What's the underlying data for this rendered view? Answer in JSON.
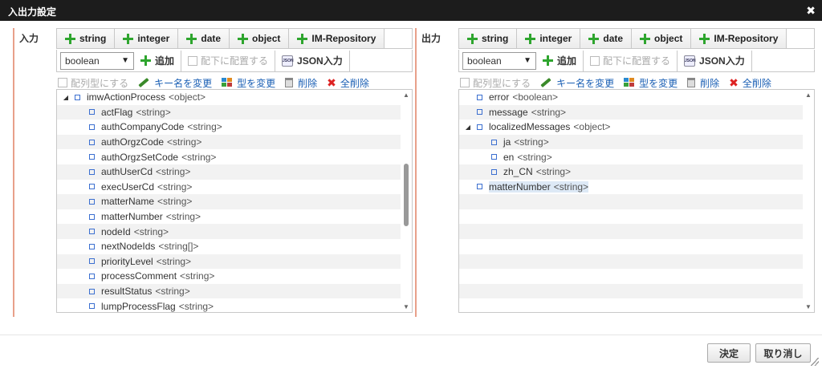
{
  "window": {
    "title": "入出力設定",
    "close_icon": "close-icon"
  },
  "input": {
    "label": "入力",
    "type_buttons": [
      "string",
      "integer",
      "date",
      "object",
      "IM-Repository"
    ],
    "select_value": "boolean",
    "add_label": "追加",
    "place_under_label": "配下に配置する",
    "json_input_label": "JSON入力",
    "make_array_label": "配列型にする",
    "rename_key_label": "キー名を変更",
    "change_type_label": "型を変更",
    "delete_label": "削除",
    "delete_all_label": "全削除",
    "tree": [
      {
        "name": "imwActionProcess",
        "type": "<object>",
        "level": 0,
        "expandable": true
      },
      {
        "name": "actFlag",
        "type": "<string>",
        "level": 1
      },
      {
        "name": "authCompanyCode",
        "type": "<string>",
        "level": 1
      },
      {
        "name": "authOrgzCode",
        "type": "<string>",
        "level": 1
      },
      {
        "name": "authOrgzSetCode",
        "type": "<string>",
        "level": 1
      },
      {
        "name": "authUserCd",
        "type": "<string>",
        "level": 1
      },
      {
        "name": "execUserCd",
        "type": "<string>",
        "level": 1
      },
      {
        "name": "matterName",
        "type": "<string>",
        "level": 1
      },
      {
        "name": "matterNumber",
        "type": "<string>",
        "level": 1
      },
      {
        "name": "nodeId",
        "type": "<string>",
        "level": 1
      },
      {
        "name": "nextNodeIds",
        "type": "<string[]>",
        "level": 1
      },
      {
        "name": "priorityLevel",
        "type": "<string>",
        "level": 1
      },
      {
        "name": "processComment",
        "type": "<string>",
        "level": 1
      },
      {
        "name": "resultStatus",
        "type": "<string>",
        "level": 1
      },
      {
        "name": "lumpProcessFlag",
        "type": "<string>",
        "level": 1
      }
    ]
  },
  "output": {
    "label": "出力",
    "type_buttons": [
      "string",
      "integer",
      "date",
      "object",
      "IM-Repository"
    ],
    "select_value": "boolean",
    "add_label": "追加",
    "place_under_label": "配下に配置する",
    "json_input_label": "JSON入力",
    "make_array_label": "配列型にする",
    "rename_key_label": "キー名を変更",
    "change_type_label": "型を変更",
    "delete_label": "削除",
    "delete_all_label": "全削除",
    "tree": [
      {
        "name": "error",
        "type": "<boolean>",
        "level": 0
      },
      {
        "name": "message",
        "type": "<string>",
        "level": 0
      },
      {
        "name": "localizedMessages",
        "type": "<object>",
        "level": 0,
        "expandable": true
      },
      {
        "name": "ja",
        "type": "<string>",
        "level": 1
      },
      {
        "name": "en",
        "type": "<string>",
        "level": 1
      },
      {
        "name": "zh_CN",
        "type": "<string>",
        "level": 1
      },
      {
        "name": "matterNumber",
        "type": "<string>",
        "level": 0,
        "selected": true
      }
    ]
  },
  "footer": {
    "ok_label": "決定",
    "cancel_label": "取り消し"
  },
  "colors": {
    "titlebar": "#1c1c1c",
    "accent": "#e8a08a",
    "plus": "#2ea52e",
    "link": "#1a5fb4"
  }
}
